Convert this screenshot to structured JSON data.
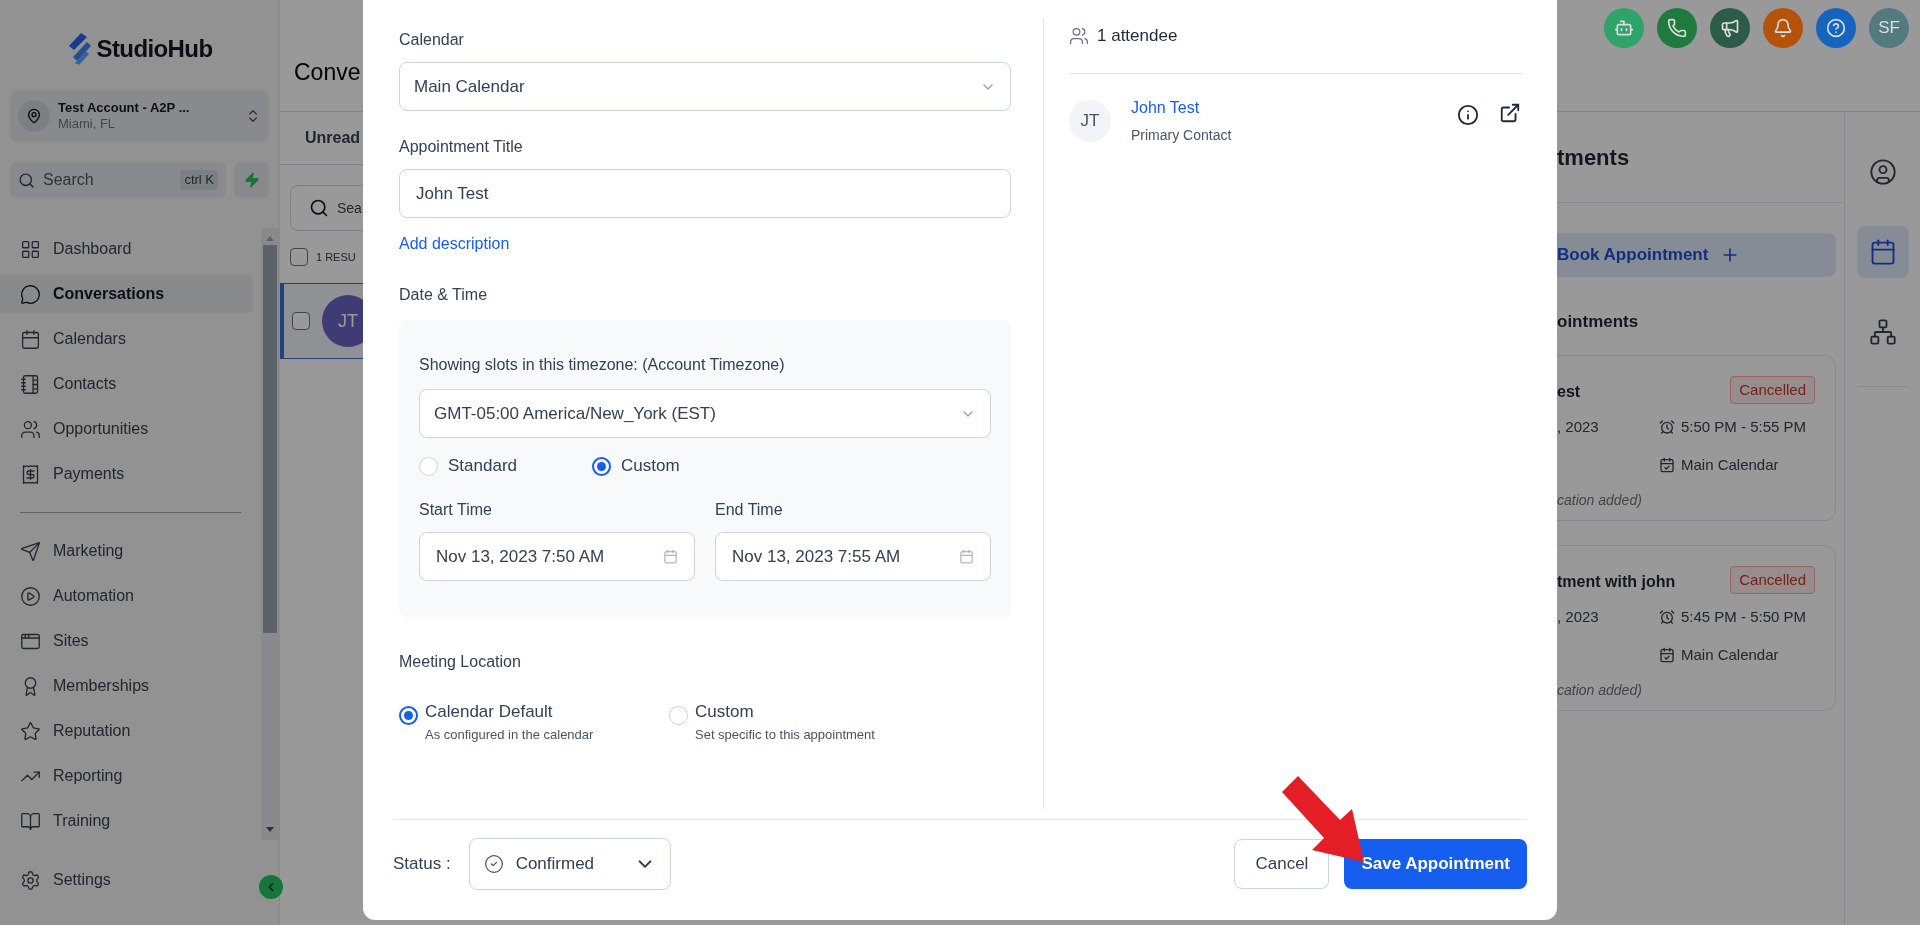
{
  "sidebar": {
    "logo": "StudioHub",
    "account": {
      "name": "Test Account - A2P ...",
      "location": "Miami, FL"
    },
    "search": {
      "placeholder": "Search",
      "shortcut": "ctrl K"
    },
    "nav": [
      {
        "kind": "dashboard",
        "label": "Dashboard",
        "selected": false
      },
      {
        "kind": "conversations",
        "label": "Conversations",
        "selected": true
      },
      {
        "kind": "calendars",
        "label": "Calendars",
        "selected": false
      },
      {
        "kind": "contacts",
        "label": "Contacts",
        "selected": false
      },
      {
        "kind": "opportunities",
        "label": "Opportunities",
        "selected": false
      },
      {
        "kind": "payments",
        "label": "Payments",
        "selected": false
      }
    ],
    "nav_secondary": [
      {
        "kind": "marketing",
        "label": "Marketing",
        "selected": false
      },
      {
        "kind": "automation",
        "label": "Automation",
        "selected": false
      },
      {
        "kind": "sites",
        "label": "Sites",
        "selected": false
      },
      {
        "kind": "memberships",
        "label": "Memberships",
        "selected": false
      },
      {
        "kind": "reputation",
        "label": "Reputation",
        "selected": false
      },
      {
        "kind": "reporting",
        "label": "Reporting",
        "selected": false
      },
      {
        "kind": "training",
        "label": "Training",
        "selected": false
      }
    ],
    "settings": "Settings"
  },
  "header": {
    "title": "Conve",
    "icons": [
      {
        "kind": "robot",
        "color": "#2ea36a"
      },
      {
        "kind": "phone",
        "color": "#1f7a3d"
      },
      {
        "kind": "megaphone",
        "color": "#2a5c47"
      },
      {
        "kind": "bell",
        "color": "#b5530a"
      },
      {
        "kind": "help",
        "color": "#1565c0"
      }
    ],
    "user_initials": "SF"
  },
  "conversations": {
    "tab": "Unread",
    "search_placeholder": "Sea",
    "select_all": {
      "checked": false
    },
    "results": "1 RESU",
    "rows": [
      {
        "initials": "JT",
        "selected": true,
        "checked": false
      }
    ]
  },
  "appointments": {
    "title": "tments",
    "book_button": "Book Appointment",
    "section": "ointments",
    "cards": [
      {
        "title": "est",
        "status": "Cancelled",
        "date": ", 2023",
        "time": "5:50 PM - 5:55 PM",
        "calendar": "Main Calendar",
        "location": "cation added)"
      },
      {
        "title": "tment with john",
        "status": "Cancelled",
        "date": ", 2023",
        "time": "5:45 PM - 5:50 PM",
        "calendar": "Main Calendar",
        "location": "cation added)"
      }
    ]
  },
  "right_rail": [
    {
      "kind": "person",
      "selected": false
    },
    {
      "kind": "calendar",
      "selected": true
    },
    {
      "kind": "network",
      "selected": false
    }
  ],
  "modal": {
    "calendar": {
      "label": "Calendar",
      "value": "Main Calendar"
    },
    "title_field": {
      "label": "Appointment Title",
      "value": "John Test"
    },
    "add_description": "Add description",
    "date_time": {
      "label": "Date & Time",
      "timezone_label": "Showing slots in this timezone: (Account Timezone)",
      "timezone": "GMT-05:00 America/New_York (EST)",
      "modes": [
        {
          "label": "Standard",
          "selected": false
        },
        {
          "label": "Custom",
          "selected": true
        }
      ],
      "start": {
        "label": "Start Time",
        "value": "Nov 13, 2023 7:50 AM"
      },
      "end": {
        "label": "End Time",
        "value": "Nov 13, 2023 7:55 AM"
      }
    },
    "meeting_location": {
      "label": "Meeting Location",
      "options": [
        {
          "label": "Calendar Default",
          "description": "As configured in the calendar",
          "selected": true
        },
        {
          "label": "Custom",
          "description": "Set specific to this appointment",
          "selected": false
        }
      ]
    },
    "attendees": {
      "count": "1 attendee",
      "list": [
        {
          "initials": "JT",
          "name": "John Test",
          "role": "Primary Contact"
        }
      ]
    },
    "status": {
      "label": "Status :",
      "value": "Confirmed"
    },
    "buttons": [
      {
        "kind": "secondary",
        "label": "Cancel"
      },
      {
        "kind": "primary",
        "label": "Save Appointment"
      }
    ]
  }
}
